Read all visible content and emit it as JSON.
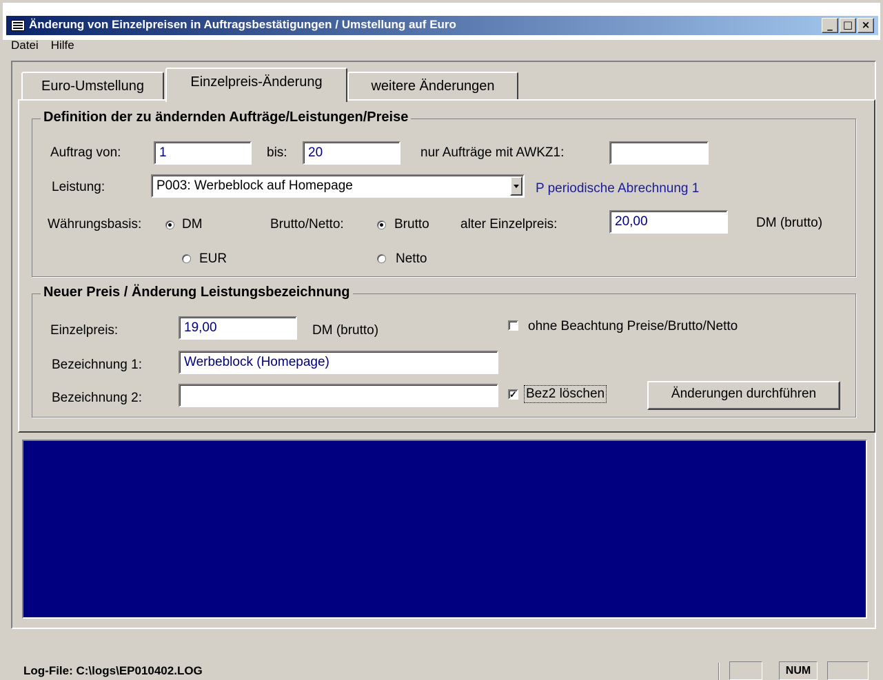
{
  "window": {
    "title": "Änderung von Einzelpreisen in Auftragsbestätigungen / Umstellung auf Euro",
    "buttons": {
      "minimize": "_",
      "maximize": "□",
      "close": "×"
    }
  },
  "menu": [
    "Datei",
    "Hilfe"
  ],
  "tabs": [
    {
      "label": "Euro-Umstellung",
      "active": false
    },
    {
      "label": "Einzelpreis-Änderung",
      "active": true
    },
    {
      "label": "weitere Änderungen",
      "active": false
    }
  ],
  "definition": {
    "title": "Definition der zu ändernden Aufträge/Leistungen/Preise",
    "auftrag_von_label": "Auftrag von:",
    "auftrag_von_value": "1",
    "bis_label": "bis:",
    "bis_value": "20",
    "awkz_label": "nur Aufträge mit AWKZ1:",
    "awkz_value": "",
    "leistung_label": "Leistung:",
    "leistung_value": "P003: Werbeblock auf Homepage",
    "leistung_info": "P periodische Abrechnung 1",
    "waehrung_label": "Währungsbasis:",
    "waehrung_options": [
      "DM",
      "EUR"
    ],
    "waehrung_selected": "DM",
    "bruttonetto_label": "Brutto/Netto:",
    "bruttonetto_options": [
      "Brutto",
      "Netto"
    ],
    "bruttonetto_selected": "Brutto",
    "alter_preis_label": "alter Einzelpreis:",
    "alter_preis_value": "20,00",
    "alter_preis_unit": "DM (brutto)"
  },
  "neu": {
    "title": "Neuer Preis / Änderung Leistungsbezeichnung",
    "einzelpreis_label": "Einzelpreis:",
    "einzelpreis_value": "19,00",
    "einzelpreis_unit": "DM (brutto)",
    "ohne_beachtung_label": "ohne Beachtung Preise/Brutto/Netto",
    "ohne_beachtung_checked": false,
    "bez1_label": "Bezeichnung 1:",
    "bez1_value": "Werbeblock (Homepage)",
    "bez2_label": "Bezeichnung 2:",
    "bez2_value": "",
    "bez2_loeschen_label": "Bez2 löschen",
    "bez2_loeschen_checked": true,
    "apply_button": "Änderungen durchführen"
  },
  "log_pane": {
    "background": "#000080"
  },
  "status": {
    "logfile": "Log-File: C:\\logs\\EP010402.LOG",
    "indicators": [
      "",
      "NUM",
      ""
    ]
  }
}
